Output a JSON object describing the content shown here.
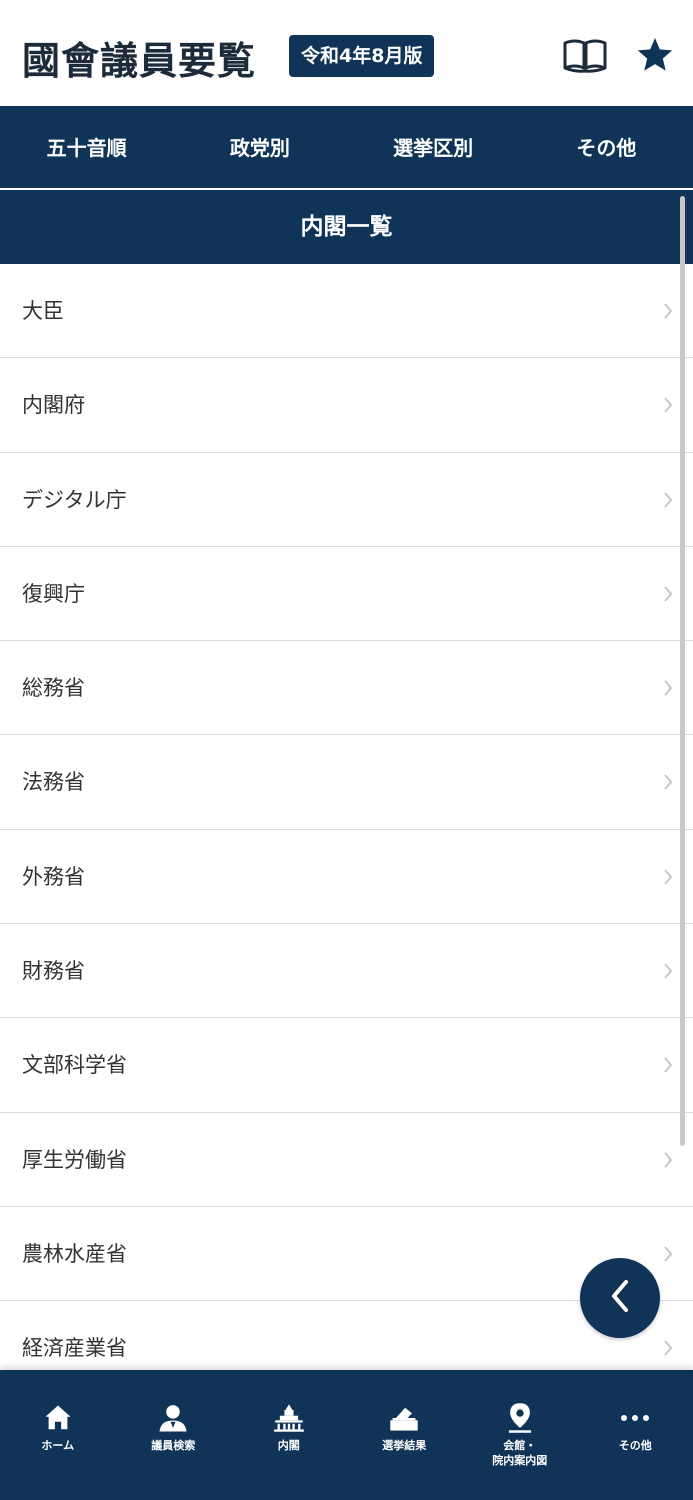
{
  "header": {
    "title": "國會議員要覧",
    "edition": "令和4年8月版",
    "icons": [
      "book-open-icon",
      "star-icon"
    ]
  },
  "top_nav": {
    "items": [
      {
        "label": "五十音順"
      },
      {
        "label": "政党別"
      },
      {
        "label": "選挙区別"
      },
      {
        "label": "その他"
      }
    ]
  },
  "section": {
    "title": "内閣一覧"
  },
  "list": {
    "items": [
      {
        "label": "大臣"
      },
      {
        "label": "内閣府"
      },
      {
        "label": "デジタル庁"
      },
      {
        "label": "復興庁"
      },
      {
        "label": "総務省"
      },
      {
        "label": "法務省"
      },
      {
        "label": "外務省"
      },
      {
        "label": "財務省"
      },
      {
        "label": "文部科学省"
      },
      {
        "label": "厚生労働省"
      },
      {
        "label": "農林水産省"
      },
      {
        "label": "経済産業省"
      }
    ]
  },
  "fab": {
    "icon": "chevron-left-icon"
  },
  "bottom_nav": {
    "items": [
      {
        "label": "ホーム",
        "icon": "home-icon"
      },
      {
        "label": "議員検索",
        "icon": "person-search-icon"
      },
      {
        "label": "内閣",
        "icon": "diet-building-icon"
      },
      {
        "label": "選挙結果",
        "icon": "ballot-box-icon"
      },
      {
        "label": "会館・\n院内案内図",
        "icon": "map-pin-icon"
      },
      {
        "label": "その他",
        "icon": "more-icon"
      }
    ]
  },
  "colors": {
    "primary": "#0f3457",
    "background": "#ffffff",
    "divider": "#dcdcdc"
  }
}
